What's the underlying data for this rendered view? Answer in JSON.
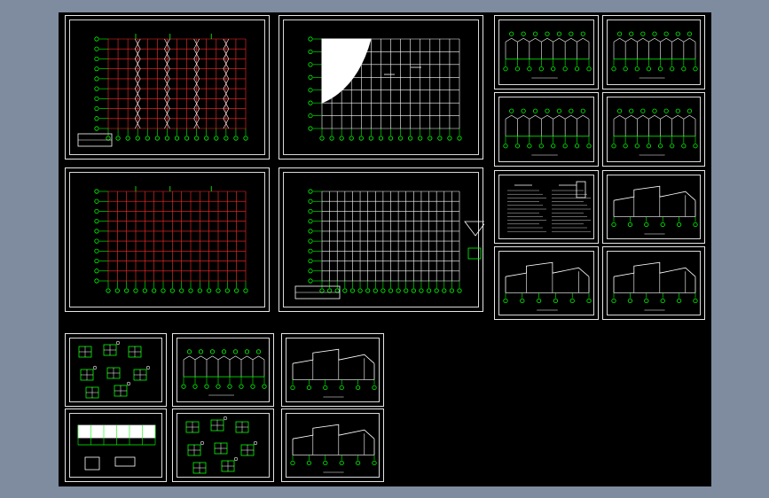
{
  "colors": {
    "frame": "#7f8ca0",
    "canvas": "#000000",
    "sheet_border": "#e6e6e6",
    "grid_green": "#00ff00",
    "member_red": "#ff2a2a",
    "line_white": "#ffffff"
  },
  "drawing_sheets": [
    {
      "id": "sheet-column-layout-plan",
      "kind": "column-plan"
    },
    {
      "id": "sheet-roof-plan",
      "kind": "roof-plan"
    },
    {
      "id": "sheet-purlin-layout-plan",
      "kind": "red-grid"
    },
    {
      "id": "sheet-roof-bracing-plan",
      "kind": "white-grid"
    },
    {
      "id": "sheet-elevation-1",
      "kind": "elevation"
    },
    {
      "id": "sheet-elevation-2",
      "kind": "elevation"
    },
    {
      "id": "sheet-elevation-3",
      "kind": "elevation"
    },
    {
      "id": "sheet-elevation-4",
      "kind": "elevation"
    },
    {
      "id": "sheet-design-notes",
      "kind": "notes"
    },
    {
      "id": "sheet-frame-section-1",
      "kind": "section"
    },
    {
      "id": "sheet-frame-section-2",
      "kind": "section"
    },
    {
      "id": "sheet-frame-section-3",
      "kind": "section"
    },
    {
      "id": "sheet-connection-details-1",
      "kind": "details"
    },
    {
      "id": "sheet-elevation-5",
      "kind": "elevation"
    },
    {
      "id": "sheet-frame-section-4",
      "kind": "section"
    },
    {
      "id": "sheet-wall-elevation",
      "kind": "wall"
    },
    {
      "id": "sheet-connection-details-2",
      "kind": "details"
    },
    {
      "id": "sheet-frame-section-5",
      "kind": "section"
    }
  ]
}
